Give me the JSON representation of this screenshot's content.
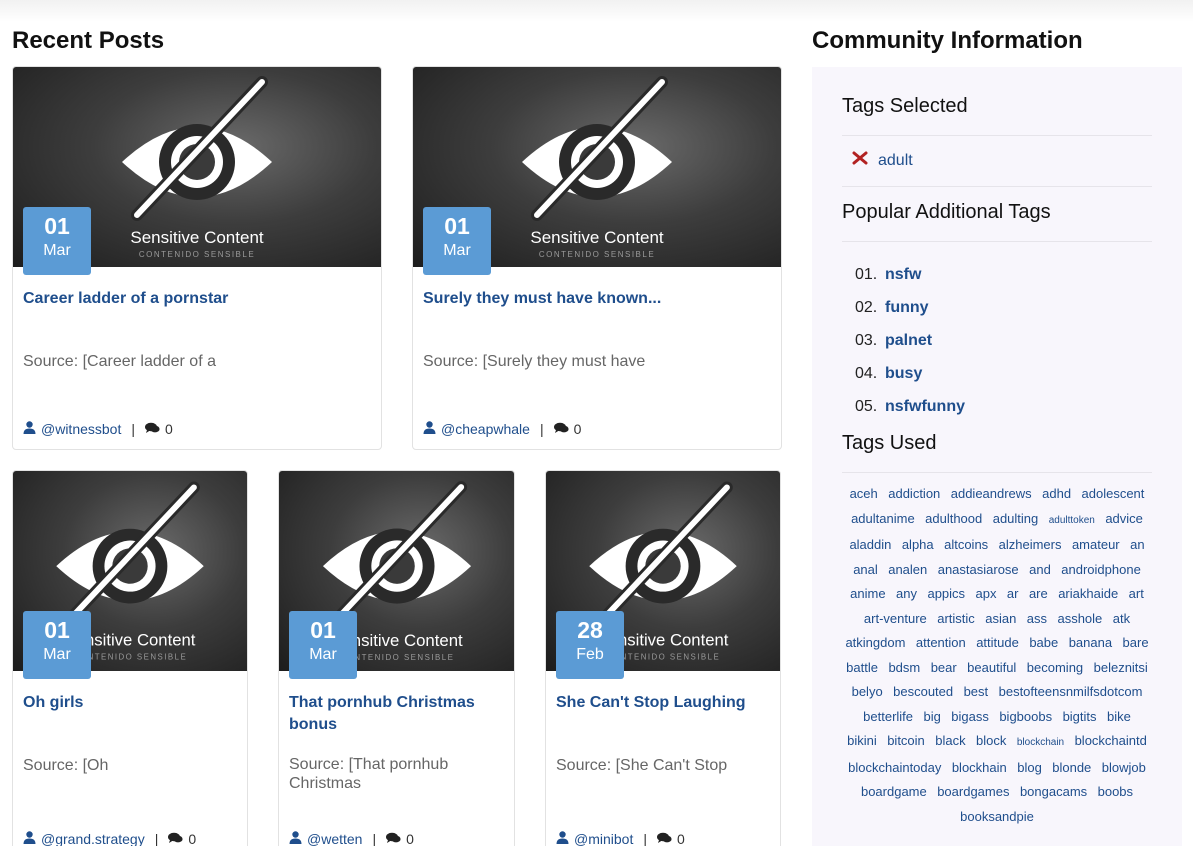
{
  "headings": {
    "recent_posts": "Recent Posts",
    "community_information": "Community Information"
  },
  "image_overlay": {
    "title": "Sensitive Content",
    "subtitle": "CONTENIDO SENSIBLE"
  },
  "posts": [
    {
      "day": "01",
      "month": "Mar",
      "title": "Career ladder of a pornstar",
      "source": "Source: [Career ladder of a",
      "author": "@witnessbot",
      "comments": "0"
    },
    {
      "day": "01",
      "month": "Mar",
      "title": "Surely they must have known...",
      "source": "Source: [Surely they must have",
      "author": "@cheapwhale",
      "comments": "0"
    },
    {
      "day": "01",
      "month": "Mar",
      "title": "Oh girls",
      "source": "Source: [Oh",
      "author": "@grand.strategy",
      "comments": "0"
    },
    {
      "day": "01",
      "month": "Mar",
      "title": "That pornhub Christmas bonus",
      "source": "Source: [That pornhub Christmas",
      "author": "@wetten",
      "comments": "0"
    },
    {
      "day": "28",
      "month": "Feb",
      "title": "She Can't Stop Laughing",
      "source": "Source: [She Can't Stop",
      "author": "@minibot",
      "comments": "0"
    }
  ],
  "sidebar": {
    "tags_selected_heading": "Tags Selected",
    "selected_tag": "adult",
    "popular_heading": "Popular Additional Tags",
    "popular": [
      {
        "num": "01.",
        "name": "nsfw"
      },
      {
        "num": "02.",
        "name": "funny"
      },
      {
        "num": "03.",
        "name": "palnet"
      },
      {
        "num": "04.",
        "name": "busy"
      },
      {
        "num": "05.",
        "name": "nsfwfunny"
      }
    ],
    "tags_used_heading": "Tags Used",
    "tags_used": [
      "aceh",
      "addiction",
      "addieandrews",
      "adhd",
      "adolescent",
      "adultanime",
      "adulthood",
      "adulting",
      "adulttoken",
      "advice",
      "aladdin",
      "alpha",
      "altcoins",
      "alzheimers",
      "amateur",
      "an",
      "anal",
      "analen",
      "anastasiarose",
      "and",
      "androidphone",
      "anime",
      "any",
      "appics",
      "apx",
      "ar",
      "are",
      "ariakhaide",
      "art",
      "art-venture",
      "artistic",
      "asian",
      "ass",
      "asshole",
      "atk",
      "atkingdom",
      "attention",
      "attitude",
      "babe",
      "banana",
      "bare",
      "battle",
      "bdsm",
      "bear",
      "beautiful",
      "becoming",
      "beleznitsi",
      "belyo",
      "bescouted",
      "best",
      "bestofteensnmilfsdotcom",
      "betterlife",
      "big",
      "bigass",
      "bigboobs",
      "bigtits",
      "bike",
      "bikini",
      "bitcoin",
      "black",
      "block",
      "blockchain",
      "blockchaintd",
      "blockchaintoday",
      "blockhain",
      "blog",
      "blonde",
      "blowjob",
      "boardgame",
      "boardgames",
      "bongacams",
      "boobs",
      "booksandpie"
    ]
  },
  "colors": {
    "link": "#1f4e8c",
    "date_badge": "#5b9bd5",
    "sidebar_bg": "#f8f6fc",
    "remove_icon": "#b22222"
  }
}
